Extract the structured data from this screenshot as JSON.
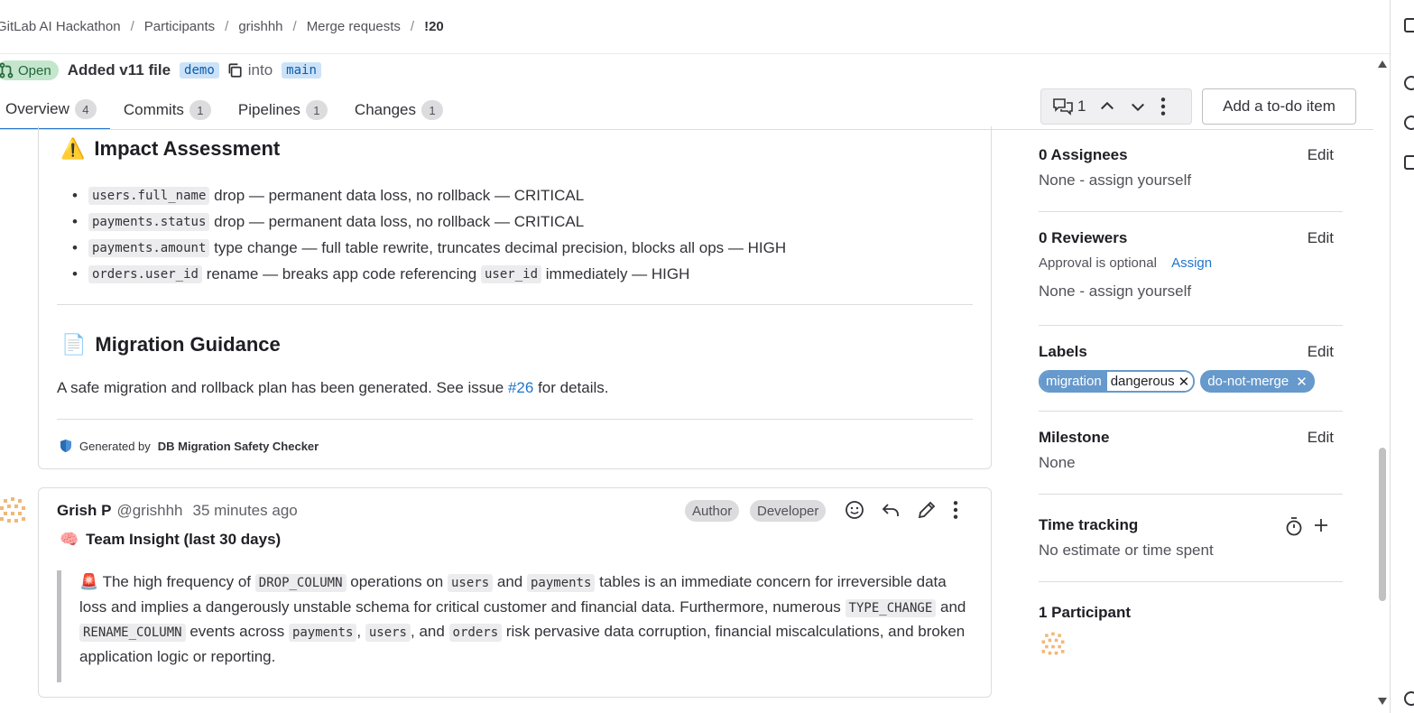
{
  "breadcrumb": [
    "GitLab AI Hackathon",
    "Participants",
    "grishhh",
    "Merge requests",
    "!20"
  ],
  "mr": {
    "status": "Open",
    "title": "Added v11 file",
    "source_branch": "demo",
    "into_text": "into",
    "target_branch": "main"
  },
  "tabs": [
    {
      "label": "Overview",
      "count": "4"
    },
    {
      "label": "Commits",
      "count": "1"
    },
    {
      "label": "Pipelines",
      "count": "1"
    },
    {
      "label": "Changes",
      "count": "1"
    }
  ],
  "toolbar": {
    "comment_count": "1",
    "todo_label": "Add a to-do item"
  },
  "impact": {
    "emoji": "⚠️",
    "heading": "Impact Assessment",
    "items": [
      {
        "code": "users.full_name",
        "text": "drop — permanent data loss, no rollback — CRITICAL"
      },
      {
        "code": "payments.status",
        "text": "drop — permanent data loss, no rollback — CRITICAL"
      },
      {
        "code": "payments.amount",
        "text": "type change — full table rewrite, truncates decimal precision, blocks all ops — HIGH"
      },
      {
        "code": "orders.user_id",
        "text": "rename — breaks app code referencing",
        "code2": "user_id",
        "text2": "immediately — HIGH"
      }
    ]
  },
  "guidance": {
    "emoji": "📄",
    "heading": "Migration Guidance",
    "text_before": "A safe migration and rollback plan has been generated. See issue",
    "issue_link": "#26",
    "text_after": "for details."
  },
  "generated": {
    "prefix": "Generated by",
    "tool": "DB Migration Safety Checker"
  },
  "note": {
    "author": "Grish P",
    "handle": "@grishhh",
    "time": "35 minutes ago",
    "badges": [
      "Author",
      "Developer"
    ],
    "insight_emoji": "🧠",
    "insight_title": "Team Insight (last 30 days)",
    "quote": {
      "emoji": "🚨",
      "t1": "The high frequency of",
      "c1": "DROP_COLUMN",
      "t2": "operations on",
      "c2": "users",
      "t3": "and",
      "c3": "payments",
      "t4": "tables is an immediate concern for irreversible data loss and implies a dangerously unstable schema for critical customer and financial data. Furthermore, numerous",
      "c4": "TYPE_CHANGE",
      "t5": "and",
      "c5": "RENAME_COLUMN",
      "t6": "events across",
      "c6": "payments",
      "t7": ",",
      "c7": "users",
      "t8": ", and",
      "c8": "orders",
      "t9": "risk pervasive data corruption, financial miscalculations, and broken application logic or reporting."
    }
  },
  "sidebar": {
    "assignees": {
      "title": "0 Assignees",
      "edit": "Edit",
      "value": "None - assign yourself"
    },
    "reviewers": {
      "title": "0 Reviewers",
      "edit": "Edit",
      "approval": "Approval is optional",
      "assign": "Assign",
      "value": "None - assign yourself"
    },
    "labels": {
      "title": "Labels",
      "edit": "Edit",
      "scoped_key": "migration",
      "scoped_value": "dangerous",
      "label2": "do-not-merge"
    },
    "milestone": {
      "title": "Milestone",
      "edit": "Edit",
      "value": "None"
    },
    "time_tracking": {
      "title": "Time tracking",
      "value": "No estimate or time spent"
    },
    "participants": {
      "title": "1 Participant"
    }
  },
  "colors": {
    "accent": "#1f75cb",
    "label": "#6699cc",
    "open_badge": "#c3e6cd"
  }
}
